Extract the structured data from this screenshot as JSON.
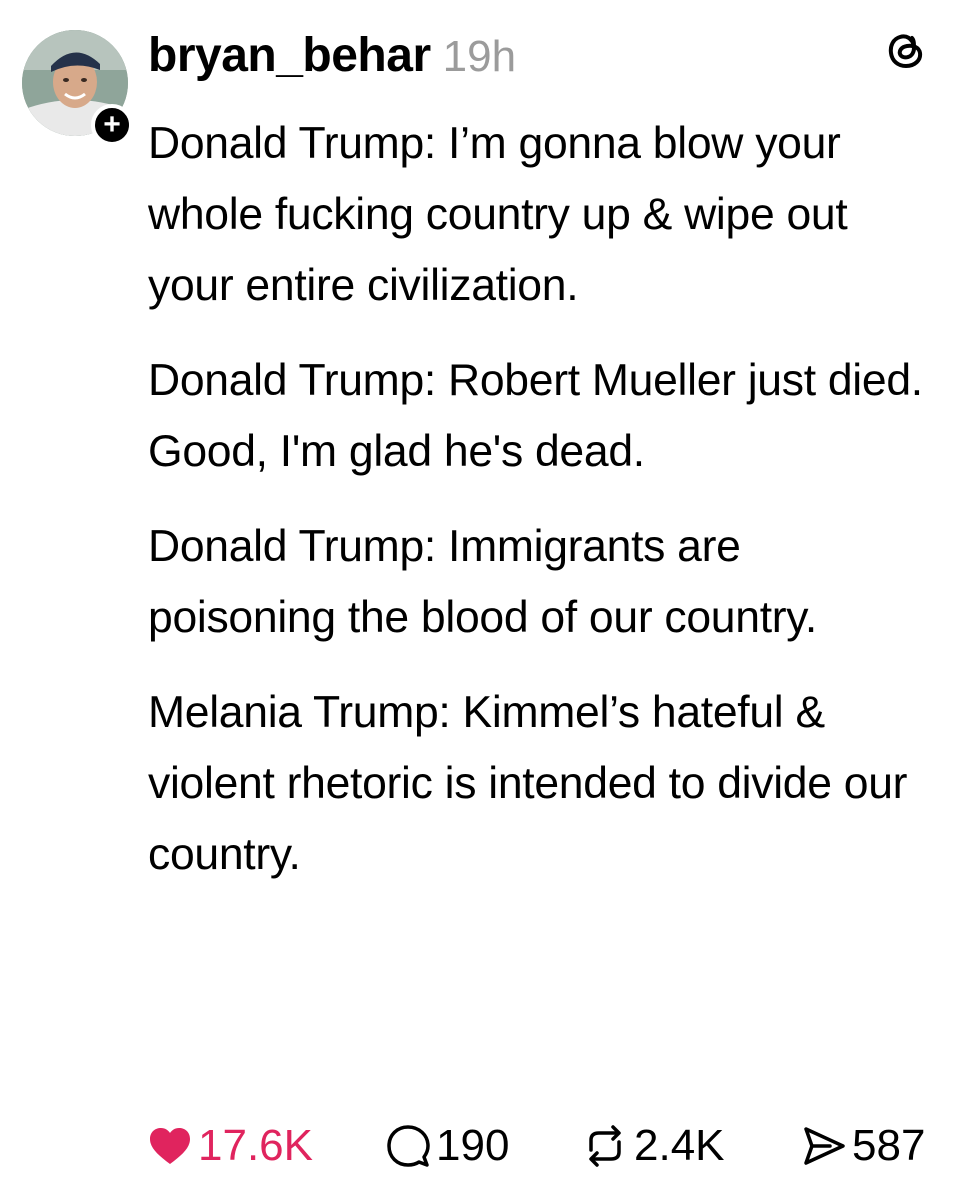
{
  "post": {
    "username": "bryan_behar",
    "timestamp": "19h",
    "follow_symbol": "+",
    "paragraphs": [
      "Donald Trump: I’m gonna blow your whole fucking country up & wipe out your entire civilization.",
      "Donald Trump: Robert Mueller just died. Good, I'm glad he's dead.",
      "Donald Trump: Immigrants are poisoning the blood of our country.",
      "Melania Trump: Kimmel’s hateful & violent rhetoric is intended to divide our country."
    ]
  },
  "actions": {
    "likes": "17.6K",
    "comments": "190",
    "reposts": "2.4K",
    "shares": "587"
  },
  "icons": {
    "like": "heart-icon",
    "comment": "comment-bubble-icon",
    "repost": "repost-icon",
    "share": "send-icon",
    "app": "threads-logo-icon"
  },
  "colors": {
    "like": "#e0245e",
    "timestamp": "#9b9b9b",
    "text": "#000000"
  }
}
